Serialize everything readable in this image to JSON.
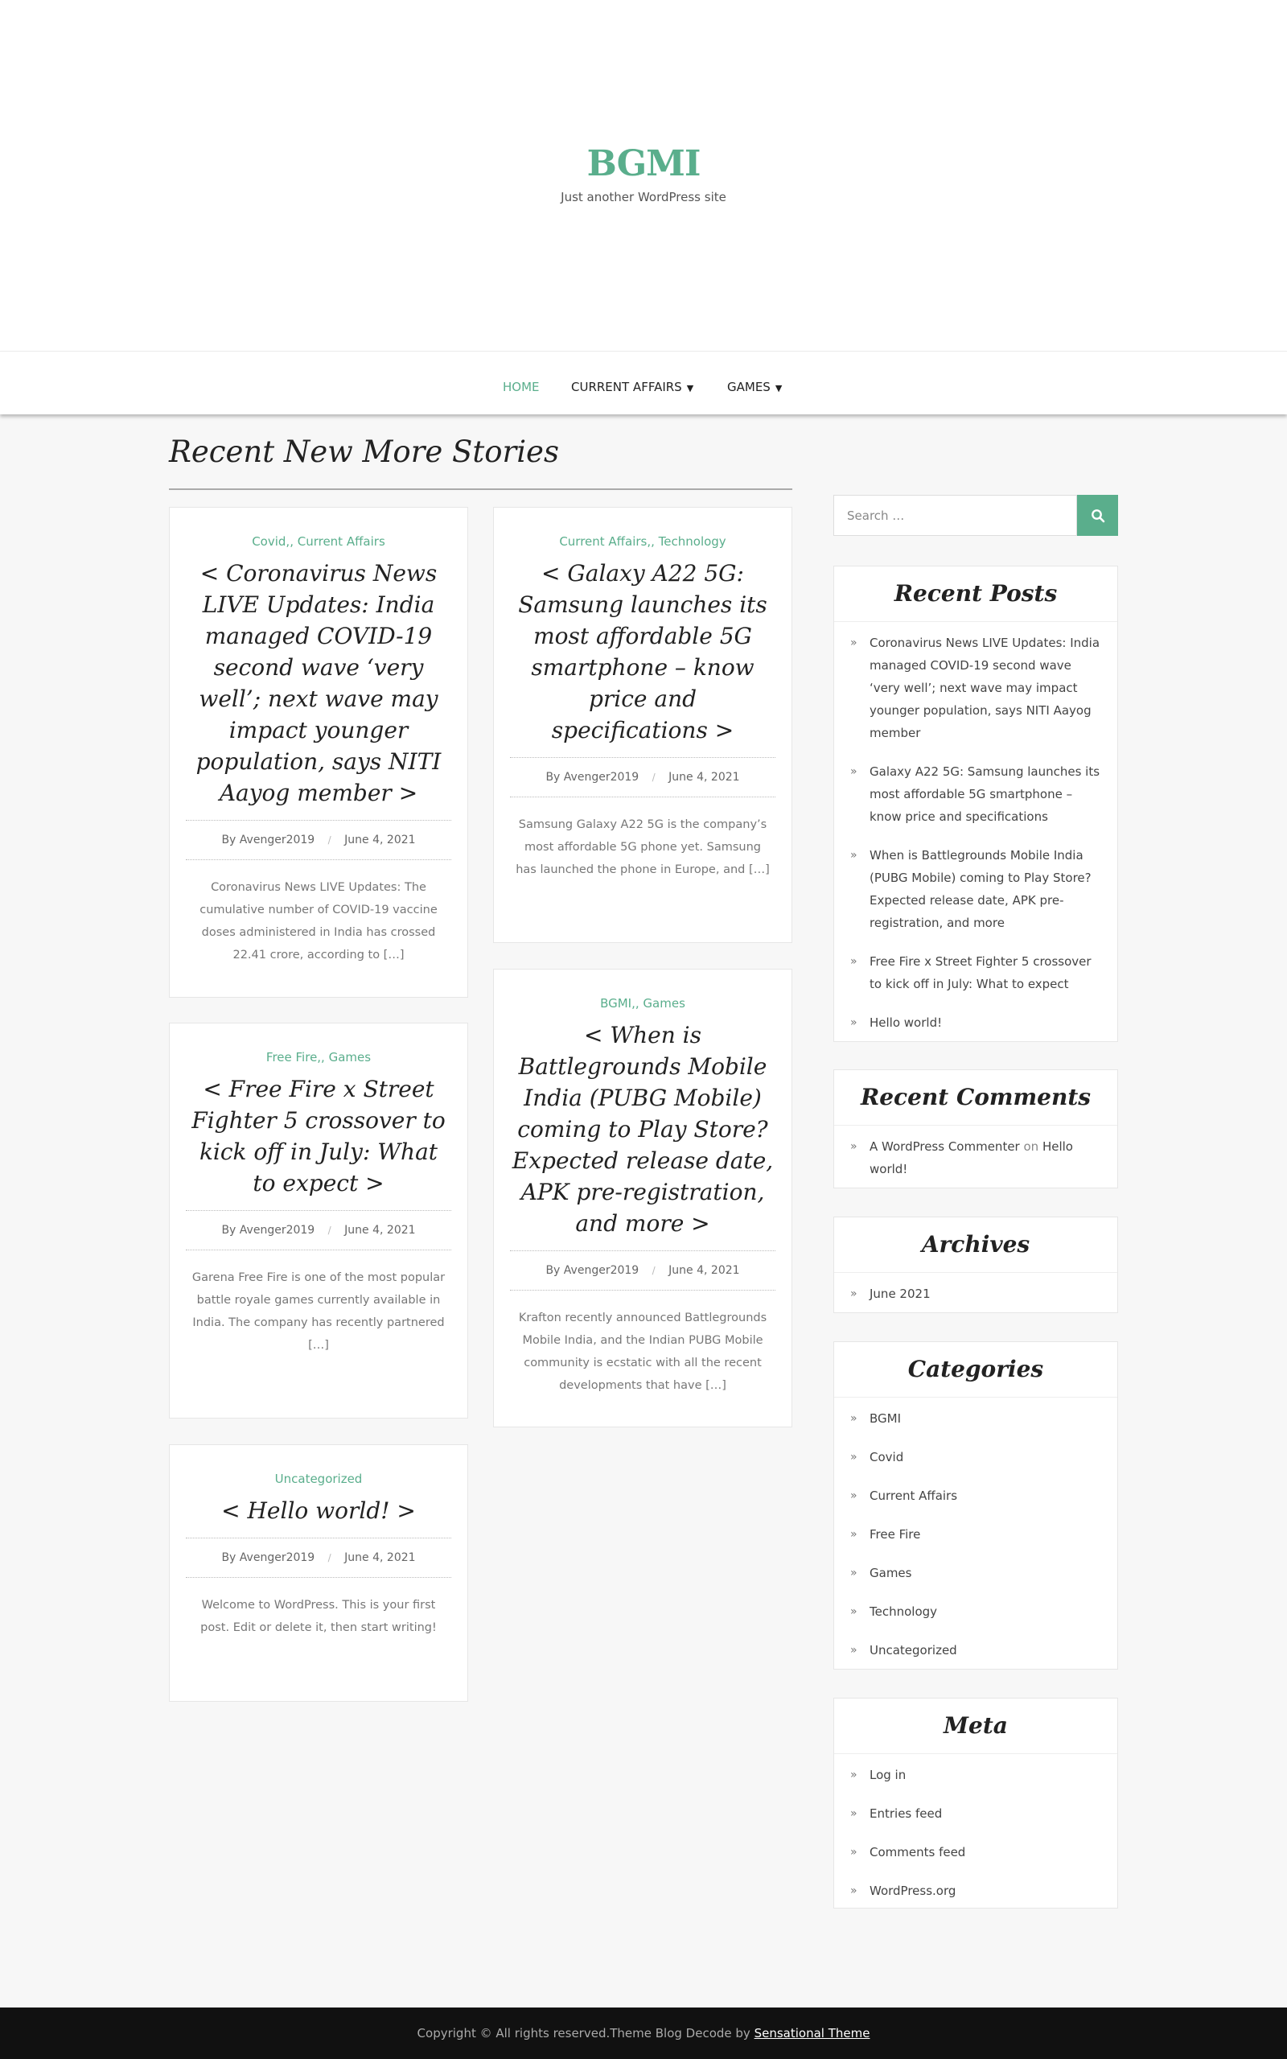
{
  "site": {
    "title": "BGMI",
    "tagline": "Just another WordPress site"
  },
  "nav": {
    "items": [
      {
        "label": "HOME",
        "active": true
      },
      {
        "label": "CURRENT AFFAIRS",
        "has_dropdown": true
      },
      {
        "label": "GAMES",
        "has_dropdown": true
      }
    ]
  },
  "main": {
    "section_title": "Recent New More Stories",
    "posts": [
      {
        "categories": "Covid,, Current Affairs",
        "title": "< Coronavirus News LIVE Updates: India managed COVID-19 second wave ‘very well’; next wave may impact younger population, says NITI Aayog member >",
        "author_prefix": "By",
        "author": "Avenger2019",
        "date": "June 4, 2021",
        "excerpt": "Coronavirus News LIVE Updates: The cumulative number of COVID-19 vaccine doses administered in India has crossed 22.41 crore, according to […]"
      },
      {
        "categories": "Current Affairs,, Technology",
        "title": "< Galaxy A22 5G: Samsung launches its most affordable 5G smartphone – know price and specifications >",
        "author_prefix": "By",
        "author": "Avenger2019",
        "date": "June 4, 2021",
        "excerpt": "Samsung Galaxy A22 5G is the company’s most affordable 5G phone yet. Samsung has launched the phone in Europe, and […]"
      },
      {
        "categories": "BGMI,, Games",
        "title": "< When is Battlegrounds Mobile India (PUBG Mobile) coming to Play Store? Expected release date, APK pre-registration, and more >",
        "author_prefix": "By",
        "author": "Avenger2019",
        "date": "June 4, 2021",
        "excerpt": "Krafton recently announced Battlegrounds Mobile India, and the Indian PUBG Mobile community is ecstatic with all the recent developments that have […]"
      },
      {
        "categories": "Free Fire,, Games",
        "title": "< Free Fire x Street Fighter 5 crossover to kick off in July: What to expect >",
        "author_prefix": "By",
        "author": "Avenger2019",
        "date": "June 4, 2021",
        "excerpt": "Garena Free Fire is one of the most popular battle royale games currently available in India. The company has recently partnered […]"
      },
      {
        "categories": "Uncategorized",
        "title": "< Hello world! >",
        "author_prefix": "By",
        "author": "Avenger2019",
        "date": "June 4, 2021",
        "excerpt": "Welcome to WordPress. This is your first post. Edit or delete it, then start writing!"
      }
    ]
  },
  "sidebar": {
    "search": {
      "placeholder": "Search …",
      "button_icon": "search-icon"
    },
    "recent_posts": {
      "title": "Recent Posts",
      "items": [
        "Coronavirus News LIVE Updates: India managed COVID-19 second wave ‘very well’; next wave may impact younger population, says NITI Aayog member",
        "Galaxy A22 5G: Samsung launches its most affordable 5G smartphone – know price and specifications",
        "When is Battlegrounds Mobile India (PUBG Mobile) coming to Play Store? Expected release date, APK pre-registration, and more",
        "Free Fire x Street Fighter 5 crossover to kick off in July: What to expect",
        "Hello world!"
      ]
    },
    "recent_comments": {
      "title": "Recent Comments",
      "author": "A WordPress Commenter",
      "on": "on",
      "post": "Hello world!"
    },
    "archives": {
      "title": "Archives",
      "items": [
        "June 2021"
      ]
    },
    "categories": {
      "title": "Categories",
      "items": [
        "BGMI",
        "Covid",
        "Current Affairs",
        "Free Fire",
        "Games",
        "Technology",
        "Uncategorized"
      ]
    },
    "meta": {
      "title": "Meta",
      "items": [
        "Log in",
        "Entries feed",
        "Comments feed",
        "WordPress.org"
      ]
    }
  },
  "footer": {
    "text": "Copyright © All rights reserved.Theme Blog Decode by",
    "link": "Sensational Theme"
  },
  "colors": {
    "accent": "#5aae8c",
    "footer_bg": "#111111",
    "page_bg": "#f7f7f7"
  }
}
